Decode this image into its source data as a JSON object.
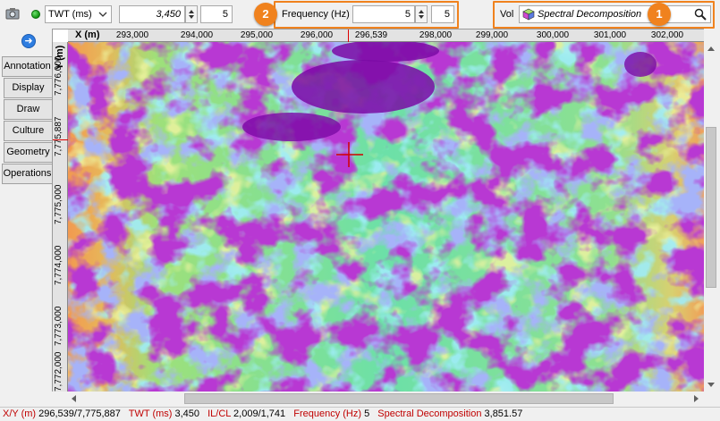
{
  "toolbar": {
    "domain_selector": "TWT (ms)",
    "twt_value": "3,450",
    "twt_step": "5",
    "frequency_label": "Frequency (Hz)",
    "frequency_value": "5",
    "frequency_step": "5",
    "vol_label": "Vol",
    "vol_name": "Spectral Decomposition"
  },
  "callouts": [
    "1",
    "2"
  ],
  "side_tabs": [
    "Annotation",
    "Display",
    "Draw",
    "Culture",
    "Geometry",
    "Operations"
  ],
  "map": {
    "x_axis_label": "X (m)",
    "y_axis_label": "Y (m)",
    "x_ticks": [
      "293,000",
      "294,000",
      "295,000",
      "296,000",
      "296,539",
      "298,000",
      "299,000",
      "300,000",
      "301,000",
      "302,000"
    ],
    "y_ticks": [
      "7,776,000",
      "7,775,887",
      "7,775,000",
      "7,774,000",
      "7,773,000",
      "7,772,000"
    ],
    "cursor_color": "#d00000"
  },
  "status": [
    {
      "key": "X/Y (m)",
      "value": "296,539/7,775,887"
    },
    {
      "key": "TWT (ms)",
      "value": "3,450"
    },
    {
      "key": "IL/CL",
      "value": "2,009/1,741"
    },
    {
      "key": "Frequency (Hz)",
      "value": "5"
    },
    {
      "key": "Spectral Decomposition",
      "value": "3,851.57"
    }
  ],
  "colors": {
    "accent": "#f0821e",
    "status_key": "#c00000",
    "map_low": "#7a0aa5",
    "map_mid": "#5ee0a0",
    "map_high": "#f0a050"
  }
}
